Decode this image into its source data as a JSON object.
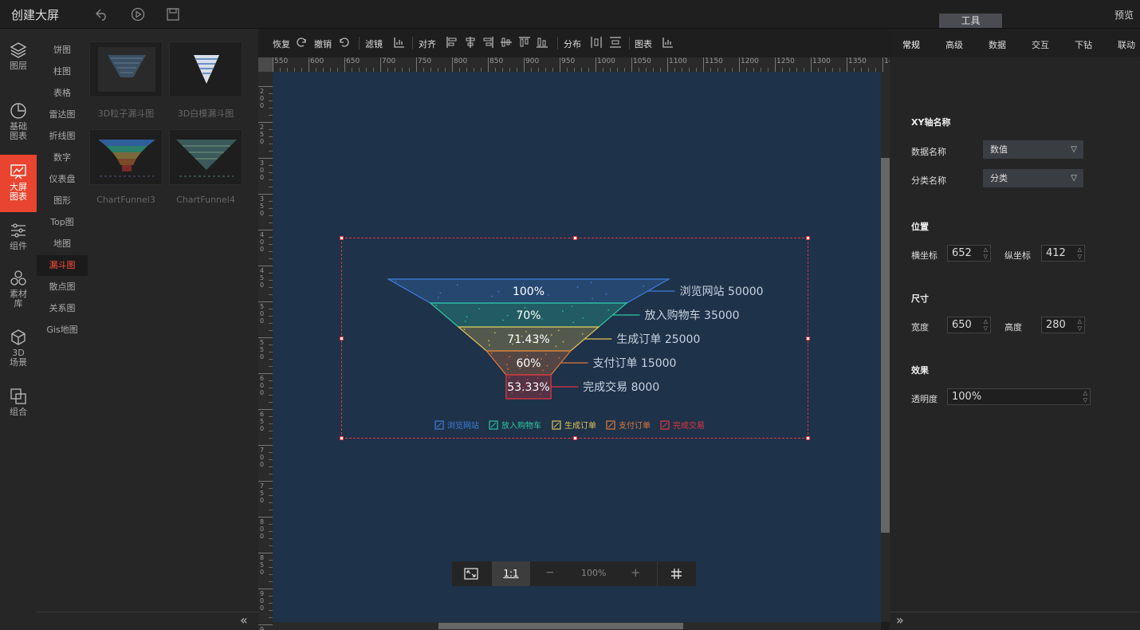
{
  "app": {
    "title": "创建大屏",
    "preview": "预览",
    "tools_tab": "工具"
  },
  "leftnav": [
    {
      "label1": "图层",
      "label2": "",
      "icon": "layers-icon"
    },
    {
      "label1": "基础",
      "label2": "图表",
      "icon": "clock-chart-icon"
    },
    {
      "label1": "大屏",
      "label2": "图表",
      "icon": "screen-chart-icon",
      "active": true
    },
    {
      "label1": "组件",
      "label2": "",
      "icon": "sliders-icon"
    },
    {
      "label1": "素材",
      "label2": "库",
      "icon": "hexagons-icon"
    },
    {
      "label1": "3D",
      "label2": "场景",
      "icon": "cube-icon"
    },
    {
      "label1": "组合",
      "label2": "",
      "icon": "combine-icon"
    }
  ],
  "categories": [
    "饼图",
    "柱图",
    "表格",
    "雷达图",
    "折线图",
    "数字",
    "仪表盘",
    "图形",
    "Top图",
    "地图",
    "漏斗图",
    "散点图",
    "关系图",
    "Gis地图"
  ],
  "active_category": "漏斗图",
  "thumbnails": [
    "3D粒子漏斗图",
    "3D白模漏斗图",
    "ChartFunnel3",
    "ChartFunnel4"
  ],
  "toolbar": {
    "redo": "恢复",
    "undo": "撤销",
    "filter": "滤镜",
    "align": "对齐",
    "distribute": "分布",
    "chart": "图表"
  },
  "ruler_h": [
    "550",
    "600",
    "650",
    "700",
    "750",
    "800",
    "850",
    "900",
    "950",
    "1000",
    "1050",
    "1100",
    "1150",
    "1200",
    "1250",
    "1300",
    "1350",
    "140"
  ],
  "ruler_v": [
    "200",
    "250",
    "300",
    "350",
    "400",
    "450",
    "500",
    "550",
    "600",
    "650",
    "700",
    "750",
    "800",
    "850",
    "900",
    "950"
  ],
  "zoom": {
    "ratio": "1:1",
    "minus": "−",
    "level": "100%",
    "plus": "+"
  },
  "chart_data": {
    "type": "funnel",
    "categories": [
      "浏览网站",
      "放入购物车",
      "生成订单",
      "支付订单",
      "完成交易"
    ],
    "values": [
      50000,
      35000,
      25000,
      15000,
      8000
    ],
    "percent_labels": [
      "100%",
      "70%",
      "71.43%",
      "60%",
      "53.33%"
    ],
    "colors": [
      "#3d7fd9",
      "#2fc6a0",
      "#e0c15a",
      "#e07a3b",
      "#e0373f"
    ],
    "legend_position": "bottom"
  },
  "rightpanel": {
    "tabs": [
      "常规",
      "高级",
      "数据",
      "交互",
      "下钻",
      "联动"
    ],
    "active_tab": "常规",
    "xy_title": "XY轴名称",
    "data_name_label": "数据名称",
    "data_name_value": "数值",
    "category_name_label": "分类名称",
    "category_name_value": "分类",
    "position_title": "位置",
    "x_label": "横坐标",
    "x_value": "652",
    "y_label": "纵坐标",
    "y_value": "412",
    "size_title": "尺寸",
    "width_label": "宽度",
    "width_value": "650",
    "height_label": "高度",
    "height_value": "280",
    "effect_title": "效果",
    "opacity_label": "透明度",
    "opacity_value": "100%"
  },
  "collapse_left": "«",
  "collapse_right": "»"
}
